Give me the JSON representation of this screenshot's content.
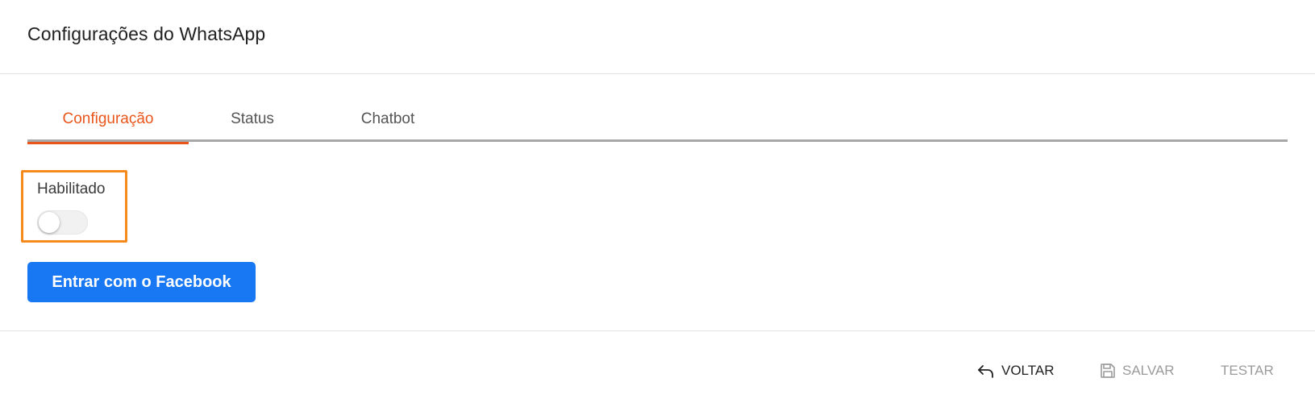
{
  "header": {
    "title": "Configurações do WhatsApp"
  },
  "tabs": [
    {
      "label": "Configuração",
      "active": true
    },
    {
      "label": "Status",
      "active": false
    },
    {
      "label": "Chatbot",
      "active": false
    }
  ],
  "enabled": {
    "label": "Habilitado",
    "value": false
  },
  "facebook_button": {
    "label": "Entrar com o Facebook"
  },
  "footer": {
    "back_label": "VOLTAR",
    "save_label": "SALVAR",
    "test_label": "TESTAR"
  },
  "colors": {
    "accent": "#e8561b",
    "highlight_border": "#f78a1d",
    "facebook_blue": "#1877f2",
    "disabled_text": "#9b9b9b"
  },
  "icons": {
    "back": "undo-arrow-icon",
    "save": "floppy-disk-icon"
  }
}
